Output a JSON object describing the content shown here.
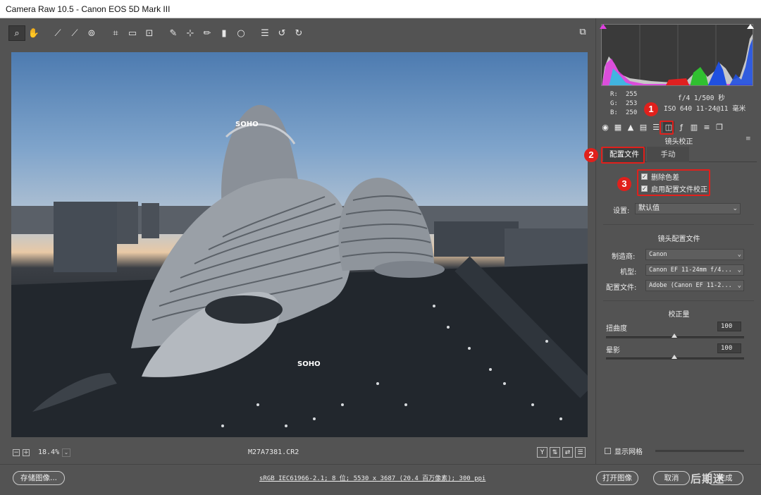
{
  "window": {
    "title": "Camera Raw 10.5 -  Canon EOS 5D Mark III"
  },
  "toolbar": {
    "tools": [
      {
        "name": "zoom-tool-icon",
        "glyph": "🔍",
        "active": true
      },
      {
        "name": "hand-tool-icon",
        "glyph": "✋"
      },
      {
        "name": "white-balance-tool-icon",
        "glyph": "⁄"
      },
      {
        "name": "color-sampler-tool-icon",
        "glyph": "⁄"
      },
      {
        "name": "targeted-adjustment-tool-icon",
        "glyph": "⊚"
      },
      {
        "name": "crop-tool-icon",
        "glyph": "⌗"
      },
      {
        "name": "straighten-tool-icon",
        "glyph": "▭"
      },
      {
        "name": "transform-tool-icon",
        "glyph": "⊡"
      },
      {
        "name": "spot-removal-tool-icon",
        "glyph": "✎"
      },
      {
        "name": "red-eye-removal-tool-icon",
        "glyph": "+o"
      },
      {
        "name": "adjustment-brush-icon",
        "glyph": "✏"
      },
      {
        "name": "graduated-filter-icon",
        "glyph": "▮"
      },
      {
        "name": "radial-filter-icon",
        "glyph": "○"
      },
      {
        "name": "preferences-icon",
        "glyph": "☰"
      },
      {
        "name": "rotate-left-icon",
        "glyph": "↺"
      },
      {
        "name": "rotate-right-icon",
        "glyph": "↻"
      }
    ]
  },
  "canvas": {
    "zoom_value": "18.4%",
    "filename": "M27A7381.CR2"
  },
  "info": {
    "r_label": "R:",
    "r_value": "255",
    "g_label": "G:",
    "g_value": "253",
    "b_label": "B:",
    "b_value": "250",
    "exposure": "f/4  1/500 秒",
    "iso_focal": "ISO 640   11-24@11 毫米"
  },
  "panel": {
    "section_title": "镜头校正",
    "tab_profile": "配置文件",
    "tab_manual": "手动",
    "cb_chromatic": "删除色差",
    "cb_profile": "启用配置文件校正",
    "setup_label": "设置:",
    "setup_value": "默认值",
    "lens_profile_title": "镜头配置文件",
    "make_label": "制造商:",
    "make_value": "Canon",
    "model_label": "机型:",
    "model_value": "Canon EF 11-24mm f/4...",
    "profile_label": "配置文件:",
    "profile_value": "Adobe (Canon EF 11-2...",
    "amount_title": "校正量",
    "distortion_label": "扭曲度",
    "distortion_value": "100",
    "vignetting_label": "晕影",
    "vignetting_value": "100",
    "show_grid_label": "显示网格"
  },
  "bottom": {
    "save_button": "存储图像...",
    "workflow_link": "sRGB IEC61966-2.1; 8 位; 5530 x 3687 (20.4 百万像素); 300 ppi",
    "open_button": "打开图像",
    "cancel_button": "取消",
    "done_button": "完成"
  },
  "annotations": {
    "badge_1": "1",
    "badge_2": "2",
    "badge_3": "3"
  },
  "watermark": "后期迷",
  "colors": {
    "panel_bg": "#535353",
    "callout_red": "#e0201c"
  }
}
